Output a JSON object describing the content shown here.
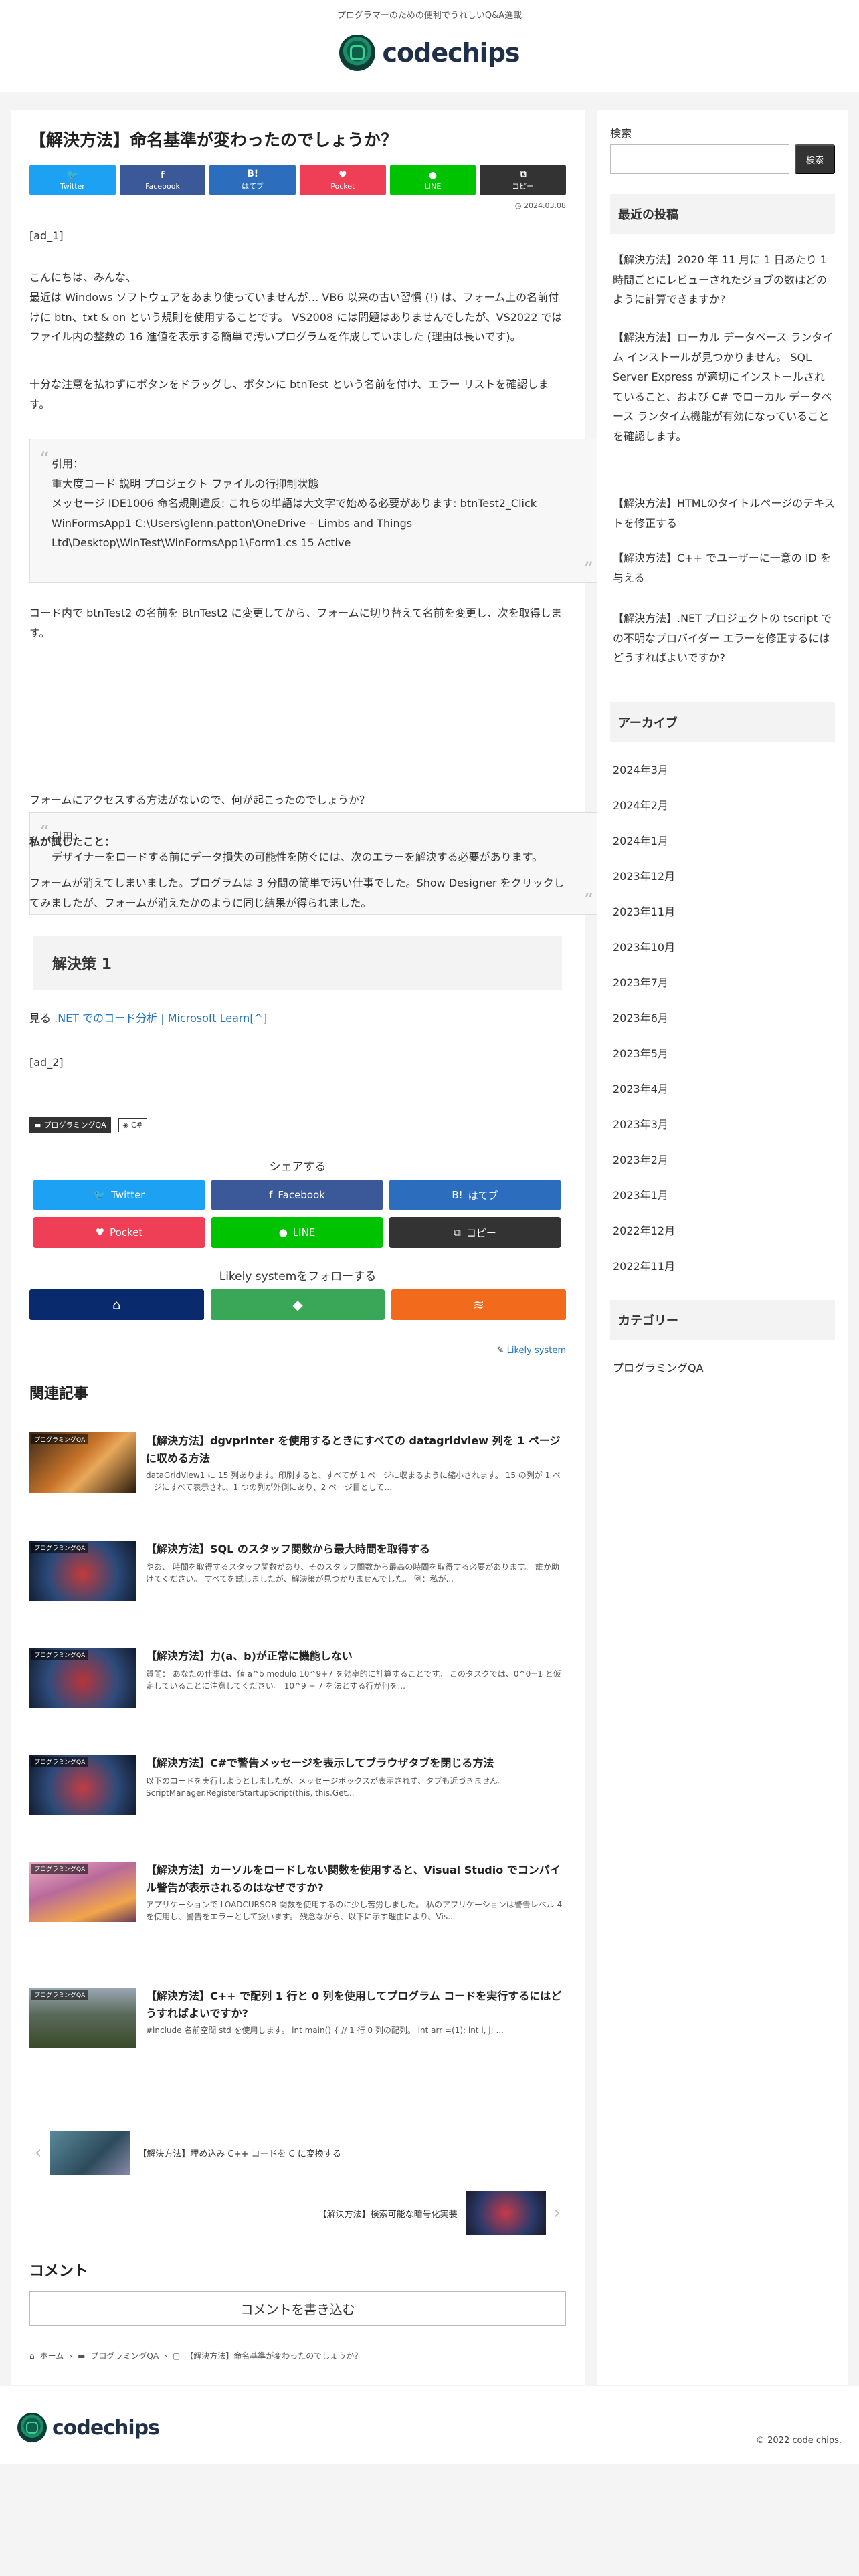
{
  "header": {
    "tagline": "プログラマーのための便利でうれしいQ&A選載",
    "logo_text": "codechips"
  },
  "article": {
    "title": "【解決方法】命名基準が変わったのでしょうか？",
    "share_top": [
      {
        "icon": "🐦",
        "label": "Twitter"
      },
      {
        "icon": "f",
        "label": "Facebook"
      },
      {
        "icon": "B!",
        "label": "はてブ"
      },
      {
        "icon": "♥",
        "label": "Pocket"
      },
      {
        "icon": "●",
        "label": "LINE"
      },
      {
        "icon": "⧉",
        "label": "コピー"
      }
    ],
    "date": "2024.03.08",
    "ad1": "[ad_1]",
    "intro": "こんにちは、みんな、",
    "para1": "最近は Windows ソフトウェアをあまり使っていませんが… VB6 以来の古い習慣 (!) は、フォーム上の名前付けに btn、txt & on という規則を使用することです。 VS2008 には問題はありませんでしたが、VS2022 ではファイル内の整数の 16 進値を表示する簡単で汚いプログラムを作成していました (理由は長いです)。",
    "para2": "十分な注意を払わずにボタンをドラッグし、ボタンに btnTest という名前を付け、エラー リストを確認します。",
    "quote1": {
      "label": "引用：",
      "line1": "重大度コード 説明 プロジェクト ファイルの行抑制状態",
      "line2": "メッセージ IDE1006 命名規則違反: これらの単語は大文字で始める必要があります: btnTest2_Click WinFormsApp1 C:\\Users\\glenn.patton\\OneDrive – Limbs and Things Ltd\\Desktop\\WinTest\\WinFormsApp1\\Form1.cs 15 Active"
    },
    "para3": "コード内で btnTest2 の名前を BtnTest2 に変更してから、フォームに切り替えて名前を変更し、次を取得します。",
    "quote2": {
      "label": "引用：",
      "line1": "デザイナーをロードする前にデータ損失の可能性を防ぐには、次のエラーを解決する必要があります。"
    },
    "para4": "フォームにアクセスする方法がないので、何が起こったのでしょうか？",
    "tried_heading": "私が試したこと：",
    "para5": "フォームが消えてしまいました。プログラムは 3 分間の簡単で汚い仕事でした。Show Designer をクリックしてみましたが、フォームが消えたかのように同じ結果が得られました。",
    "solution_heading": "解決策 1",
    "see_prefix": "見る",
    "see_link": ".NET でのコード分析 | Microsoft Learn[^]",
    "ad2": "[ad_2]",
    "tags": [
      "プログラミングQA",
      "C#"
    ],
    "share_label": "シェアする",
    "share_bottom": [
      {
        "icon": "🐦",
        "label": "Twitter"
      },
      {
        "icon": "f",
        "label": "Facebook"
      },
      {
        "icon": "B!",
        "label": "はてブ"
      },
      {
        "icon": "♥",
        "label": "Pocket"
      },
      {
        "icon": "●",
        "label": "LINE"
      },
      {
        "icon": "⧉",
        "label": "コピー"
      }
    ],
    "follow_label": "Likely systemをフォローする",
    "follow_icons": [
      "⌂",
      "◆",
      "≋"
    ],
    "edit_link": "Likely system",
    "related_heading": "関連記事",
    "related": [
      {
        "title": "【解決方法】dgvprinter を使用するときにすべての datagridview 列を 1 ページに収める方法",
        "excerpt": "dataGridView1 に 15 列あります。印刷すると、すべてが 1 ページに収まるように縮小されます。 15 の列が 1 ページにすべて表示され、1 つの列が外側にあり、2 ページ目として...",
        "thumb_label": "プログラミングQA"
      },
      {
        "title": "【解決方法】SQL のスタッフ関数から最大時間を取得する",
        "excerpt": "やあ、 時間を取得するスタッフ関数があり、そのスタッフ関数から最高の時間を取得する必要があります。 誰か助けてください。 すべてを試しましたが、解決策が見つかりませんでした。 例：私が...",
        "thumb_label": "プログラミングQA"
      },
      {
        "title": "【解決方法】力(a、b)が正常に機能しない",
        "excerpt": "質問： あなたの仕事は、値 a^b modulo 10^9+7 を効率的に計算することです。 このタスクでは、0^0=1 と仮定していることに注意してください。 10^9 + 7 を法とする行が何を...",
        "thumb_label": "プログラミングQA"
      },
      {
        "title": "【解決方法】C#で警告メッセージを表示してブラウザタブを閉じる方法",
        "excerpt": "以下のコードを実行しようとしましたが、メッセージボックスが表示されず、タブも近づきません。 ScriptManager.RegisterStartupScript(this, this.Get...",
        "thumb_label": "プログラミングQA"
      },
      {
        "title": "【解決方法】カーソルをロードしない関数を使用すると、Visual Studio でコンパイル警告が表示されるのはなぜですか?",
        "excerpt": "アプリケーションで LOADCURSOR 関数を使用するのに少し苦労しました。 私のアプリケーションは警告レベル 4 を使用し、警告をエラーとして扱います。 残念ながら、以下に示す理由により、Vis...",
        "thumb_label": "プログラミングQA"
      },
      {
        "title": "【解決方法】C++ で配列 1 行と 0 列を使用してプログラム コードを実行するにはどうすればよいですか?",
        "excerpt": "#include 名前空間 std を使用します。 int main() { // 1 行 0 列の配列。 int arr =(1); int i, j; ...",
        "thumb_label": "プログラミングQA"
      }
    ],
    "prev_post": "【解決方法】埋め込み C++ コードを C に変換する",
    "next_post": "【解決方法】検索可能な暗号化実装",
    "comments_heading": "コメント",
    "comment_button": "コメントを書き込む",
    "breadcrumb": [
      "ホーム",
      "プログラミングQA",
      "【解決方法】命名基準が変わったのでしょうか？"
    ]
  },
  "sidebar": {
    "search_label": "検索",
    "search_placeholder": "",
    "search_button": "検索",
    "recent_heading": "最近の投稿",
    "recent": [
      "【解決方法】2020 年 11 月に 1 日あたり 1 時間ごとにレビューされたジョブの数はどのように計算できますか?",
      "【解決方法】ローカル データベース ランタイム インストールが見つかりません。 SQL Server Express が適切にインストールされていること、および C# でローカル データベース ランタイム機能が有効になっていることを確認します。",
      "【解決方法】HTMLのタイトルページのテキストを修正する",
      "【解決方法】C++ でユーザーに一意の ID を与える",
      "【解決方法】.NET プロジェクトの tscript での不明なプロバイダー エラーを修正するにはどうすればよいですか?"
    ],
    "archive_heading": "アーカイブ",
    "archives": [
      "2024年3月",
      "2024年2月",
      "2024年1月",
      "2023年12月",
      "2023年11月",
      "2023年10月",
      "2023年7月",
      "2023年6月",
      "2023年5月",
      "2023年4月",
      "2023年3月",
      "2023年2月",
      "2023年1月",
      "2022年12月",
      "2022年11月"
    ],
    "category_heading": "カテゴリー",
    "categories": [
      "プログラミングQA"
    ]
  },
  "footer": {
    "logo_text": "codechips",
    "copyright": "© 2022 code chips."
  }
}
